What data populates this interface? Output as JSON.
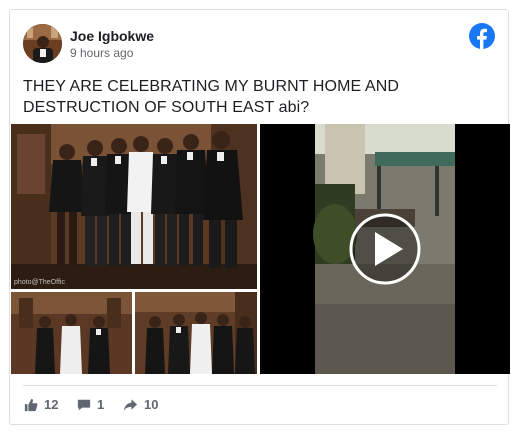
{
  "post": {
    "author": "Joe Igbokwe",
    "time": "9 hours ago",
    "text": "THEY ARE CELEBRATING MY BURNT HOME AND DESTRUCTION OF SOUTH EAST abi?",
    "watermark": "photo@TheOffic",
    "icons": {
      "brand": "facebook-logo-icon",
      "like": "thumbs-up-icon",
      "comment": "comment-icon",
      "share": "share-arrow-icon",
      "play": "play-icon"
    },
    "colors": {
      "brand": "#1877f2",
      "muted": "#606770"
    }
  },
  "stats": {
    "likes": "12",
    "comments": "1",
    "shares": "10"
  }
}
